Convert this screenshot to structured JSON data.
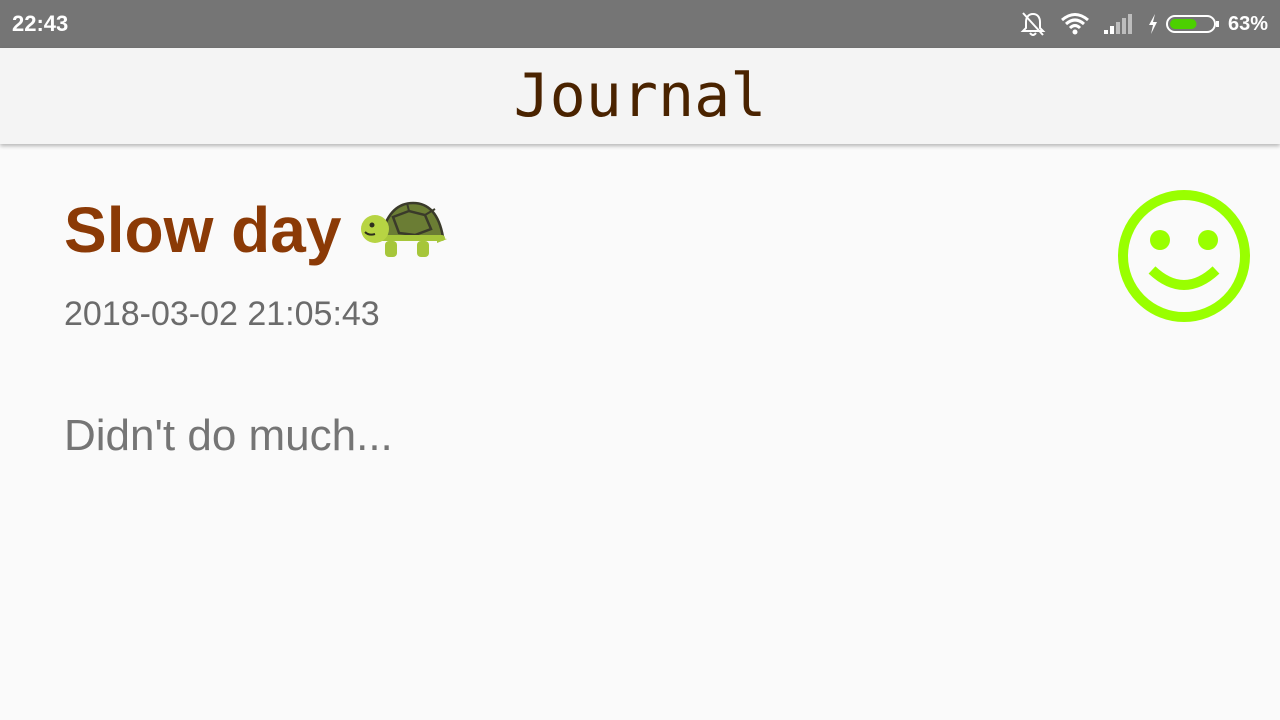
{
  "status_bar": {
    "time": "22:43",
    "battery_percent": "63%",
    "battery_level": 0.63,
    "icons": [
      "notifications-off-icon",
      "wifi-icon",
      "signal-icon",
      "charging-icon",
      "battery-icon"
    ]
  },
  "app_bar": {
    "title": "Journal"
  },
  "entry": {
    "title": "Slow day",
    "emoji_icon": "turtle-icon",
    "date": "2018-03-02 21:05:43",
    "body": "Didn't do much...",
    "mood_icon": "smiley-face-icon",
    "mood_color": "#99ff00",
    "title_color": "#8b3a06"
  }
}
